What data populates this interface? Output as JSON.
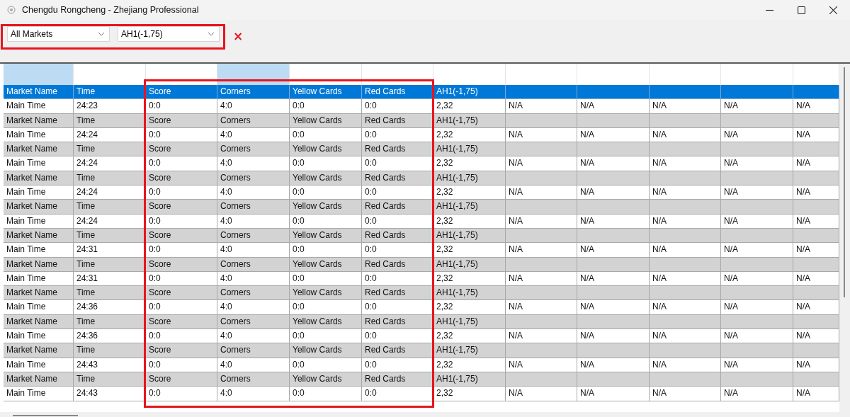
{
  "window": {
    "title": "Chengdu Rongcheng - Zhejiang Professional"
  },
  "toolbar": {
    "highlighted": true,
    "filters": [
      {
        "value": "All Markets"
      },
      {
        "value": "AH1(-1,75)"
      }
    ],
    "clear_button": "×"
  },
  "grid": {
    "columns": [
      {
        "selected": true,
        "highlighted": false
      },
      {
        "selected": false,
        "highlighted": false
      },
      {
        "selected": false,
        "highlighted": true
      },
      {
        "selected": true,
        "highlighted": true
      },
      {
        "selected": false,
        "highlighted": true
      },
      {
        "selected": false,
        "highlighted": true
      },
      {
        "selected": false,
        "highlighted": false
      },
      {
        "selected": false,
        "highlighted": false
      },
      {
        "selected": false,
        "highlighted": false
      },
      {
        "selected": false,
        "highlighted": false
      },
      {
        "selected": false,
        "highlighted": false
      },
      {
        "selected": false,
        "highlighted": false
      }
    ],
    "rows": [
      {
        "kind": "label",
        "selected": true,
        "cells": [
          "Market Name",
          "Time",
          "Score",
          "Corners",
          "Yellow Cards",
          "Red Cards",
          "AH1(-1,75)"
        ]
      },
      {
        "kind": "data",
        "selected": false,
        "cells": [
          "Main Time",
          "24:23",
          "0:0",
          "4:0",
          "0:0",
          "0:0",
          "2,32",
          "N/A",
          "N/A",
          "N/A",
          "N/A",
          "N/A"
        ]
      },
      {
        "kind": "label",
        "selected": false,
        "cells": [
          "Market Name",
          "Time",
          "Score",
          "Corners",
          "Yellow Cards",
          "Red Cards",
          "AH1(-1,75)"
        ]
      },
      {
        "kind": "data",
        "selected": false,
        "cells": [
          "Main Time",
          "24:24",
          "0:0",
          "4:0",
          "0:0",
          "0:0",
          "2,32",
          "N/A",
          "N/A",
          "N/A",
          "N/A",
          "N/A"
        ]
      },
      {
        "kind": "label",
        "selected": false,
        "cells": [
          "Market Name",
          "Time",
          "Score",
          "Corners",
          "Yellow Cards",
          "Red Cards",
          "AH1(-1,75)"
        ]
      },
      {
        "kind": "data",
        "selected": false,
        "cells": [
          "Main Time",
          "24:24",
          "0:0",
          "4:0",
          "0:0",
          "0:0",
          "2,32",
          "N/A",
          "N/A",
          "N/A",
          "N/A",
          "N/A"
        ]
      },
      {
        "kind": "label",
        "selected": false,
        "cells": [
          "Market Name",
          "Time",
          "Score",
          "Corners",
          "Yellow Cards",
          "Red Cards",
          "AH1(-1,75)"
        ]
      },
      {
        "kind": "data",
        "selected": false,
        "cells": [
          "Main Time",
          "24:24",
          "0:0",
          "4:0",
          "0:0",
          "0:0",
          "2,32",
          "N/A",
          "N/A",
          "N/A",
          "N/A",
          "N/A"
        ]
      },
      {
        "kind": "label",
        "selected": false,
        "cells": [
          "Market Name",
          "Time",
          "Score",
          "Corners",
          "Yellow Cards",
          "Red Cards",
          "AH1(-1,75)"
        ]
      },
      {
        "kind": "data",
        "selected": false,
        "cells": [
          "Main Time",
          "24:24",
          "0:0",
          "4:0",
          "0:0",
          "0:0",
          "2,32",
          "N/A",
          "N/A",
          "N/A",
          "N/A",
          "N/A"
        ]
      },
      {
        "kind": "label",
        "selected": false,
        "cells": [
          "Market Name",
          "Time",
          "Score",
          "Corners",
          "Yellow Cards",
          "Red Cards",
          "AH1(-1,75)"
        ]
      },
      {
        "kind": "data",
        "selected": false,
        "cells": [
          "Main Time",
          "24:31",
          "0:0",
          "4:0",
          "0:0",
          "0:0",
          "2,32",
          "N/A",
          "N/A",
          "N/A",
          "N/A",
          "N/A"
        ]
      },
      {
        "kind": "label",
        "selected": false,
        "cells": [
          "Market Name",
          "Time",
          "Score",
          "Corners",
          "Yellow Cards",
          "Red Cards",
          "AH1(-1,75)"
        ]
      },
      {
        "kind": "data",
        "selected": false,
        "cells": [
          "Main Time",
          "24:31",
          "0:0",
          "4:0",
          "0:0",
          "0:0",
          "2,32",
          "N/A",
          "N/A",
          "N/A",
          "N/A",
          "N/A"
        ]
      },
      {
        "kind": "label",
        "selected": false,
        "cells": [
          "Market Name",
          "Time",
          "Score",
          "Corners",
          "Yellow Cards",
          "Red Cards",
          "AH1(-1,75)"
        ]
      },
      {
        "kind": "data",
        "selected": false,
        "cells": [
          "Main Time",
          "24:36",
          "0:0",
          "4:0",
          "0:0",
          "0:0",
          "2,32",
          "N/A",
          "N/A",
          "N/A",
          "N/A",
          "N/A"
        ]
      },
      {
        "kind": "label",
        "selected": false,
        "cells": [
          "Market Name",
          "Time",
          "Score",
          "Corners",
          "Yellow Cards",
          "Red Cards",
          "AH1(-1,75)"
        ]
      },
      {
        "kind": "data",
        "selected": false,
        "cells": [
          "Main Time",
          "24:36",
          "0:0",
          "4:0",
          "0:0",
          "0:0",
          "2,32",
          "N/A",
          "N/A",
          "N/A",
          "N/A",
          "N/A"
        ]
      },
      {
        "kind": "label",
        "selected": false,
        "cells": [
          "Market Name",
          "Time",
          "Score",
          "Corners",
          "Yellow Cards",
          "Red Cards",
          "AH1(-1,75)"
        ]
      },
      {
        "kind": "data",
        "selected": false,
        "cells": [
          "Main Time",
          "24:43",
          "0:0",
          "4:0",
          "0:0",
          "0:0",
          "2,32",
          "N/A",
          "N/A",
          "N/A",
          "N/A",
          "N/A"
        ]
      },
      {
        "kind": "label",
        "selected": false,
        "cells": [
          "Market Name",
          "Time",
          "Score",
          "Corners",
          "Yellow Cards",
          "Red Cards",
          "AH1(-1,75)"
        ]
      },
      {
        "kind": "data",
        "selected": false,
        "cells": [
          "Main Time",
          "24:43",
          "0:0",
          "4:0",
          "0:0",
          "0:0",
          "2,32",
          "N/A",
          "N/A",
          "N/A",
          "N/A",
          "N/A"
        ]
      }
    ]
  }
}
